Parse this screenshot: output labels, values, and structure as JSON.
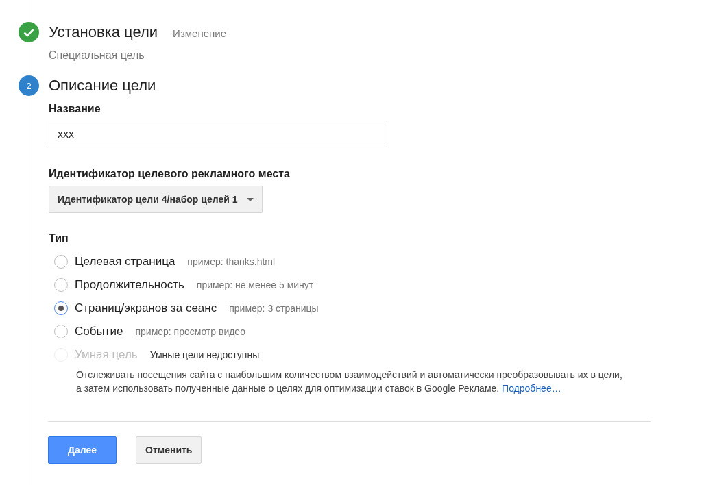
{
  "steps": [
    {
      "completed": true,
      "title": "Установка цели",
      "action": "Изменение",
      "subtitle": "Специальная цель"
    },
    {
      "completed": false,
      "number": "2",
      "title": "Описание цели"
    }
  ],
  "name_field": {
    "label": "Название",
    "value": "xxx"
  },
  "slot_select": {
    "label": "Идентификатор целевого рекламного места",
    "value": "Идентификатор цели 4/набор целей 1"
  },
  "type": {
    "label": "Тип",
    "options": [
      {
        "label": "Целевая страница",
        "example": "пример: thanks.html",
        "selected": false,
        "disabled": false
      },
      {
        "label": "Продолжительность",
        "example": "пример: не менее 5 минут",
        "selected": false,
        "disabled": false
      },
      {
        "label": "Страниц/экранов за сеанс",
        "example": "пример: 3 страницы",
        "selected": true,
        "disabled": false
      },
      {
        "label": "Событие",
        "example": "пример: просмотр видео",
        "selected": false,
        "disabled": false
      },
      {
        "label": "Умная цель",
        "example": "Умные цели недоступны",
        "selected": false,
        "disabled": true,
        "description": "Отслеживать посещения сайта с наибольшим количеством взаимодействий и автоматически преобразовывать их в цели, а затем использовать полученные данные о целях для оптимизации ставок в Google Рекламе.",
        "link": "Подробнее…"
      }
    ]
  },
  "buttons": [
    {
      "kind": "primary",
      "label": "Далее"
    },
    {
      "kind": "secondary",
      "label": "Отменить"
    }
  ]
}
